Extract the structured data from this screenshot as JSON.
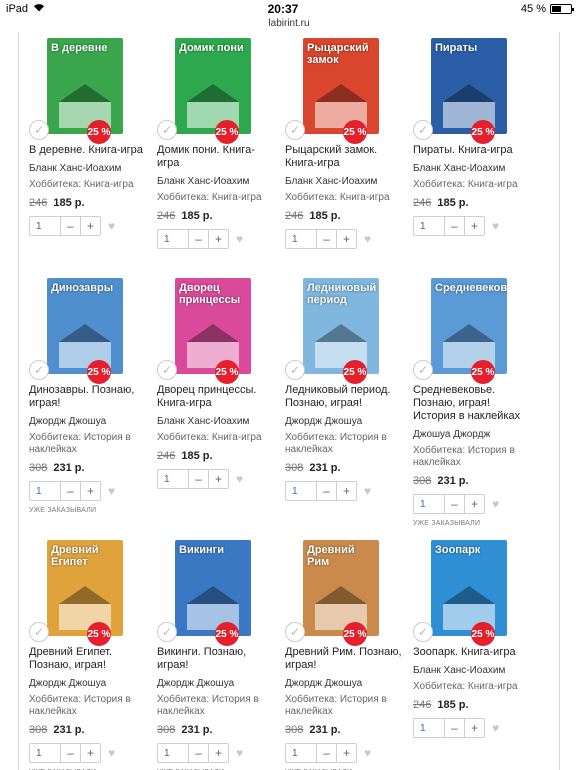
{
  "status": {
    "device": "iPad",
    "time": "20:37",
    "battery": "45 %",
    "battery_level": 0.45
  },
  "url": "labirint.ru",
  "products": [
    {
      "cover_title": "В деревне",
      "cover_color": "#3aa64c",
      "discount": "25 %",
      "name": "В деревне. Книга-игра",
      "author": "Бланк Ханс-Иоахим",
      "series": "Хоббитека: Книга-игра",
      "old_price": "246",
      "new_price": "185 р.",
      "qty": "1",
      "ordered": ""
    },
    {
      "cover_title": "Домик пони",
      "cover_color": "#2ea84f",
      "discount": "25 %",
      "name": "Домик пони. Книга-игра",
      "author": "Бланк Ханс-Иоахим",
      "series": "Хоббитека: Книга-игра",
      "old_price": "246",
      "new_price": "185 р.",
      "qty": "1",
      "ordered": ""
    },
    {
      "cover_title": "Рыцарский замок",
      "cover_color": "#d9462d",
      "discount": "25 %",
      "name": "Рыцарский замок. Книга-игра",
      "author": "Бланк Ханс-Иоахим",
      "series": "Хоббитека: Книга-игра",
      "old_price": "246",
      "new_price": "185 р.",
      "qty": "1",
      "ordered": ""
    },
    {
      "cover_title": "Пираты",
      "cover_color": "#2a5ea6",
      "discount": "25 %",
      "name": "Пираты. Книга-игра",
      "author": "Бланк Ханс-Иоахим",
      "series": "Хоббитека: Книга-игра",
      "old_price": "246",
      "new_price": "185 р.",
      "qty": "1",
      "ordered": ""
    },
    {
      "cover_title": "Динозавры",
      "cover_color": "#4f8fce",
      "discount": "25 %",
      "name": "Динозавры. Познаю, играя!",
      "author": "Джордж Джошуа",
      "series": "Хоббитека: История в наклейках",
      "old_price": "308",
      "new_price": "231 р.",
      "qty": "1",
      "ordered": "уже заказывали"
    },
    {
      "cover_title": "Дворец принцессы",
      "cover_color": "#d94a9a",
      "discount": "25 %",
      "name": "Дворец принцессы. Книга-игра",
      "author": "Бланк Ханс-Иоахим",
      "series": "Хоббитека: Книга-игра",
      "old_price": "246",
      "new_price": "185 р.",
      "qty": "1",
      "ordered": ""
    },
    {
      "cover_title": "Ледниковый период",
      "cover_color": "#7fb7df",
      "discount": "25 %",
      "name": "Ледниковый период. Познаю, играя!",
      "author": "Джордж Джошуа",
      "series": "Хоббитека: История в наклейках",
      "old_price": "308",
      "new_price": "231 р.",
      "qty": "1",
      "ordered": ""
    },
    {
      "cover_title": "Средневековье",
      "cover_color": "#5a9ad6",
      "discount": "25 %",
      "name": "Средневековье. Познаю, играя! История в наклейках",
      "author": "Джошуа Джордж",
      "series": "Хоббитека: История в наклейках",
      "old_price": "308",
      "new_price": "231 р.",
      "qty": "1",
      "ordered": "уже заказывали"
    },
    {
      "cover_title": "Древний Египет",
      "cover_color": "#e0a33c",
      "discount": "25 %",
      "name": "Древний Египет. Познаю, играя!",
      "author": "Джордж Джошуа",
      "series": "Хоббитека: История в наклейках",
      "old_price": "308",
      "new_price": "231 р.",
      "qty": "1",
      "ordered": "уже заказывали"
    },
    {
      "cover_title": "Викинги",
      "cover_color": "#3b78c4",
      "discount": "25 %",
      "name": "Викинги. Познаю, играя!",
      "author": "Джордж Джошуа",
      "series": "Хоббитека: История в наклейках",
      "old_price": "308",
      "new_price": "231 р.",
      "qty": "1",
      "ordered": "уже заказывали"
    },
    {
      "cover_title": "Древний Рим",
      "cover_color": "#c98a4b",
      "discount": "25 %",
      "name": "Древний Рим. Познаю, играя!",
      "author": "Джордж Джошуа",
      "series": "Хоббитека: История в наклейках",
      "old_price": "308",
      "new_price": "231 р.",
      "qty": "1",
      "ordered": "уже заказывали"
    },
    {
      "cover_title": "Зоопарк",
      "cover_color": "#2f8fd4",
      "discount": "25 %",
      "name": "Зоопарк. Книга-игра",
      "author": "Бланк Ханс-Иоахим",
      "series": "Хоббитека: Книга-игра",
      "old_price": "246",
      "new_price": "185 р.",
      "qty": "1",
      "ordered": ""
    }
  ],
  "icons": {
    "check": "check-icon",
    "heart": "heart-icon",
    "wifi": "wifi-icon"
  }
}
